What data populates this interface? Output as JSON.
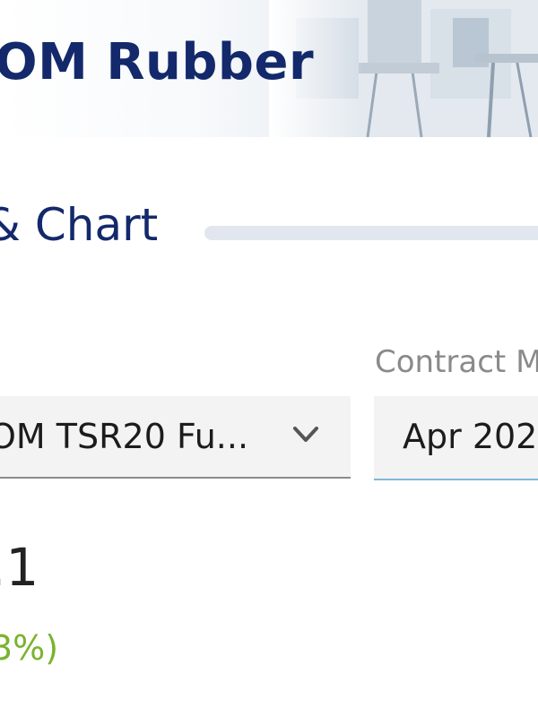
{
  "header": {
    "title": "OM Rubber"
  },
  "section": {
    "heading": "& Chart"
  },
  "filters": {
    "product": {
      "selected": "OM TSR20 Fu..."
    },
    "contract_month": {
      "label": "Contract M",
      "selected": "Apr 202"
    }
  },
  "quote": {
    "price": ".1",
    "change": "3%)"
  },
  "colors": {
    "brand": "#13296b",
    "positive": "#7ab32e",
    "focus_underline": "#7fb8d8"
  },
  "icons": {
    "product_dropdown": "chevron-down-icon"
  }
}
